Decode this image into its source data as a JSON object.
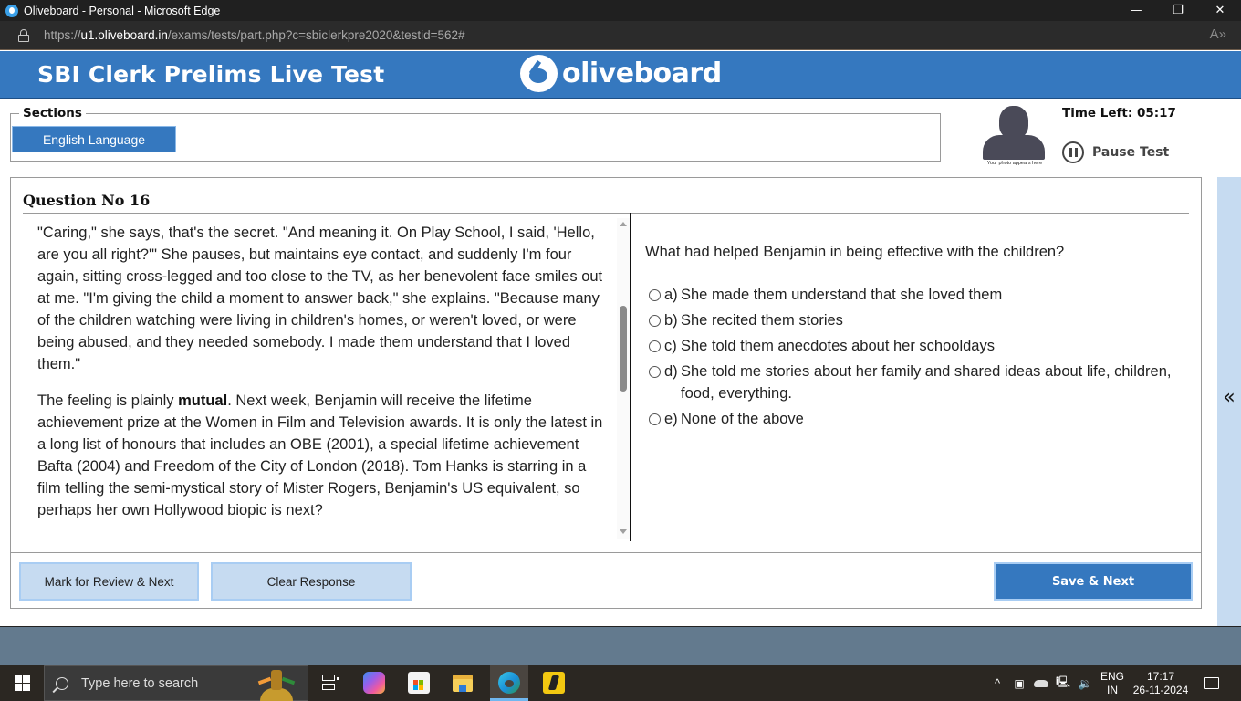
{
  "browser": {
    "window_title": "Oliveboard - Personal - Microsoft Edge",
    "url_prefix": "https://",
    "url_host": "u1.oliveboard.in",
    "url_path": "/exams/tests/part.php?c=sbiclerkpre2020&testid=562#",
    "controls": {
      "minimize": "—",
      "restore": "❐",
      "close": "✕"
    },
    "read_aloud_icon": "A»"
  },
  "header": {
    "test_title": "SBI Clerk Prelims Live Test",
    "logo_text": "oliveboard",
    "brand_color": "#3578bf"
  },
  "sections": {
    "legend": "Sections",
    "items": [
      {
        "label": "English Language",
        "active": true
      }
    ]
  },
  "candidate": {
    "photo_caption": "Your photo appears here",
    "time_left_label": "Time Left: 05:17",
    "pause_label": "Pause Test"
  },
  "question": {
    "number_label": "Question No 16",
    "passage": [
      {
        "text": "\"Caring,\" she says, that's the secret. \"And meaning it. On Play School, I said, 'Hello, are you all right?'\" She pauses, but maintains eye contact, and suddenly I'm four again, sitting cross-legged and too close to the TV, as her benevolent face smiles out at me. \"I'm giving the child a moment to answer back,\" she explains. \"Because many of the children watching were living in children's homes, or weren't loved, or were being abused, and they needed somebody. I made them understand that I loved them.\""
      },
      {
        "before": "The feeling is plainly ",
        "bold": "mutual",
        "after": ". Next week, Benjamin will receive the lifetime achievement prize at the Women in Film and Television awards. It is only the latest in a long list of honours that includes an OBE (2001), a special lifetime achievement Bafta (2004) and Freedom of the City of London (2018). Tom Hanks is starring in a film telling the semi-mystical story of Mister Rogers, Benjamin's US equivalent, so perhaps her own Hollywood biopic is next?"
      }
    ],
    "prompt": "What had helped Benjamin in being effective with the children?",
    "options": [
      {
        "letter": "a)",
        "text": "She made them understand that she loved them",
        "selected": false
      },
      {
        "letter": "b)",
        "text": "She recited them stories",
        "selected": false
      },
      {
        "letter": "c)",
        "text": "She told them anecdotes about her schooldays",
        "selected": false
      },
      {
        "letter": "d)",
        "text": "She told me stories about her family and shared ideas about life, children, food, everything.",
        "selected": false
      },
      {
        "letter": "e)",
        "text": "None of the above",
        "selected": false
      }
    ]
  },
  "actions": {
    "mark_review": "Mark for Review & Next",
    "clear_response": "Clear Response",
    "save_next": "Save & Next"
  },
  "side_panel": {
    "toggle_icon": "«"
  },
  "taskbar": {
    "search_placeholder": "Type here to search",
    "tray": {
      "up_arrow": "^",
      "lang_line1": "ENG",
      "lang_line2": "IN",
      "time": "17:17",
      "date": "26-11-2024",
      "volume_icon": "🔉"
    }
  }
}
